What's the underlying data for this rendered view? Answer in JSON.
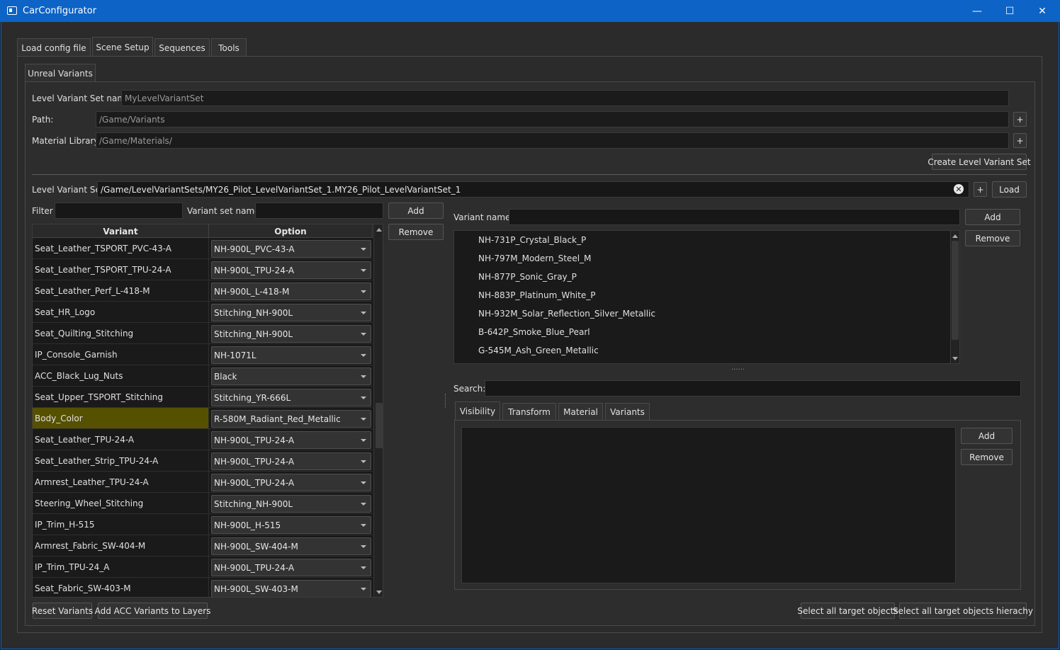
{
  "window": {
    "title": "CarConfigurator",
    "minimize_glyph": "—",
    "maximize_glyph": "☐",
    "close_glyph": "✕"
  },
  "main_tabs": [
    {
      "label": "Load config file"
    },
    {
      "label": "Scene Setup"
    },
    {
      "label": "Sequences"
    },
    {
      "label": "Tools"
    }
  ],
  "sub_tab": {
    "label": "Unreal Variants"
  },
  "form": {
    "level_variant_set_name_label": "Level Variant Set name:",
    "level_variant_set_name_value": "MyLevelVariantSet",
    "path_label": "Path:",
    "path_value": "/Game/Variants",
    "material_library_label": "Material Library:",
    "material_library_value": "/Game/Materials/",
    "plus_glyph": "+",
    "create_button": "Create Level Variant Set"
  },
  "level_variant_set": {
    "label": "Level Variant Set:",
    "value": "/Game/LevelVariantSets/MY26_Pilot_LevelVariantSet_1.MY26_Pilot_LevelVariantSet_1",
    "clear_glyph": "✕",
    "plus_glyph": "+",
    "load_button": "Load"
  },
  "left": {
    "filter_label": "Filter",
    "filter_value": "",
    "variant_set_name_label": "Variant set name:",
    "variant_set_name_value": "",
    "add_button": "Add",
    "remove_button": "Remove",
    "table": {
      "headers": [
        "Variant",
        "Option"
      ],
      "rows": [
        {
          "variant": "Seat_Leather_TSPORT_PVC-43-A",
          "option": "NH-900L_PVC-43-A"
        },
        {
          "variant": "Seat_Leather_TSPORT_TPU-24-A",
          "option": "NH-900L_TPU-24-A"
        },
        {
          "variant": "Seat_Leather_Perf_L-418-M",
          "option": "NH-900L_L-418-M"
        },
        {
          "variant": "Seat_HR_Logo",
          "option": "Stitching_NH-900L"
        },
        {
          "variant": "Seat_Quilting_Stitching",
          "option": "Stitching_NH-900L"
        },
        {
          "variant": "IP_Console_Garnish",
          "option": "NH-1071L"
        },
        {
          "variant": "ACC_Black_Lug_Nuts",
          "option": "Black"
        },
        {
          "variant": "Seat_Upper_TSPORT_Stitching",
          "option": "Stitching_YR-666L"
        },
        {
          "variant": "Body_Color",
          "option": "R-580M_Radiant_Red_Metallic",
          "selected": true
        },
        {
          "variant": "Seat_Leather_TPU-24-A",
          "option": "NH-900L_TPU-24-A"
        },
        {
          "variant": "Seat_Leather_Strip_TPU-24-A",
          "option": "NH-900L_TPU-24-A"
        },
        {
          "variant": "Armrest_Leather_TPU-24-A",
          "option": "NH-900L_TPU-24-A"
        },
        {
          "variant": "Steering_Wheel_Stitching",
          "option": "Stitching_NH-900L"
        },
        {
          "variant": "IP_Trim_H-515",
          "option": "NH-900L_H-515"
        },
        {
          "variant": "Armrest_Fabric_SW-404-M",
          "option": "NH-900L_SW-404-M"
        },
        {
          "variant": "IP_Trim_TPU-24_A",
          "option": "NH-900L_TPU-24-A"
        },
        {
          "variant": "Seat_Fabric_SW-403-M",
          "option": "NH-900L_SW-403-M"
        }
      ]
    },
    "reset_button": "Reset Variants",
    "add_acc_button": "Add ACC Variants to Layers"
  },
  "right": {
    "variant_name_label": "Variant name:",
    "variant_name_value": "",
    "add_button": "Add",
    "remove_button": "Remove",
    "variants": [
      "NH-731P_Crystal_Black_P",
      "NH-797M_Modern_Steel_M",
      "NH-877P_Sonic_Gray_P",
      "NH-883P_Platinum_White_P",
      "NH-932M_Solar_Reflection_Silver_Metallic",
      "B-642P_Smoke_Blue_Pearl",
      "G-545M_Ash_Green_Metallic"
    ],
    "splitter_glyph": "......",
    "search_label": "Search:",
    "search_value": "",
    "tabs": [
      {
        "label": "Visibility"
      },
      {
        "label": "Transform"
      },
      {
        "label": "Material"
      },
      {
        "label": "Variants"
      }
    ],
    "tab_add_button": "Add",
    "tab_remove_button": "Remove",
    "select_all_button": "Select all target objects",
    "select_all_hierarchy_button": "Select all target objects hierachy"
  }
}
